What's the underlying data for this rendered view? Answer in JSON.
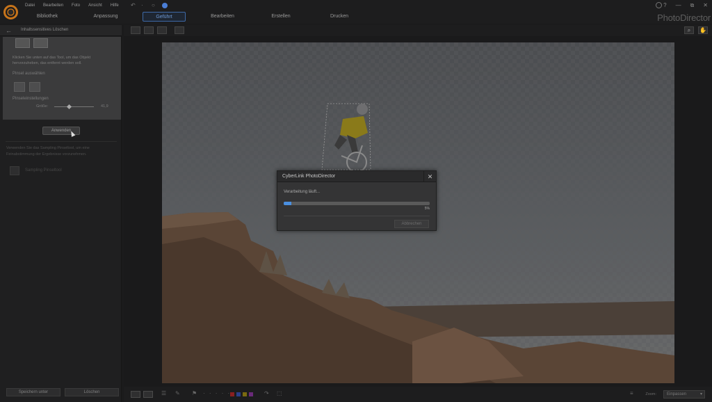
{
  "app": {
    "brand": "PhotoDirector"
  },
  "menu": [
    "Datei",
    "Bearbeiten",
    "Foto",
    "Ansicht",
    "Hilfe"
  ],
  "tabs": [
    {
      "label": "Bibliothek",
      "active": false
    },
    {
      "label": "Anpassung",
      "active": false
    },
    {
      "label": "Geführt",
      "active": true
    },
    {
      "label": "Bearbeiten",
      "active": false
    },
    {
      "label": "Erstellen",
      "active": false
    },
    {
      "label": "Drucken",
      "active": false
    }
  ],
  "window_controls": [
    "?",
    "—",
    "⧉",
    "✕"
  ],
  "left_panel": {
    "title": "Inhaltssensitives Löschen",
    "description": "Klicken Sie unten auf das Tool, um das Objekt hervorzuheben, das entfernt werden soll.",
    "brush_label": "Pinsel auswählen",
    "brush_settings_label": "Pinseleinstellungen",
    "size_label": "Größe:",
    "size_value": "41,9",
    "size_fraction": 0.37,
    "apply_label": "Anwenden",
    "hint": "Verwenden Sie das Sampling Pinseltool, um eine Feinabstimmung der Ergebnisse vorzunehmen.",
    "sampling_label": "Sampling Pinseltool",
    "save_label": "Speichern unter",
    "delete_label": "Löschen"
  },
  "dialog": {
    "title": "CyberLink PhotoDirector",
    "status": "Verarbeitung läuft...",
    "progress_percent": 5,
    "progress_label": "5%",
    "cancel_label": "Abbrechen"
  },
  "bottom_bar": {
    "zoom_label": "Zoom:",
    "zoom_value": "Einpassen",
    "colors": [
      "#8a2020",
      "#2a3f8a",
      "#7a6a10",
      "#6a2a7a"
    ]
  },
  "icons": {
    "back": "←",
    "close": "✕",
    "undo": "↶",
    "redo": "↷",
    "zoom": "🔍",
    "hand": "✋"
  }
}
